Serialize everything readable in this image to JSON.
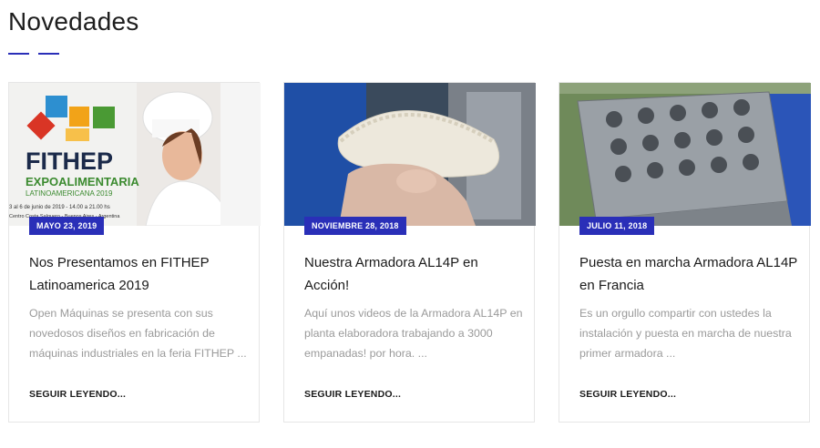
{
  "section": {
    "title": "Novedades",
    "accent_color": "#2a2fb8"
  },
  "posts": [
    {
      "date": "MAYO 23, 2019",
      "title": "Nos Presentamos en FITHEP Latinoamerica 2019",
      "excerpt": "Open Máquinas se presenta con sus novedosos diseños en fabricación de máquinas industriales en la feria FITHEP ...",
      "read_more": "SEGUIR LEYENDO...",
      "image": {
        "logo_text": "FITHEP",
        "logo_sub": "EXPOALIMENTARIA",
        "logo_sub2": "LATINOAMERICANA 2019",
        "event_info": "3 al 6 de junio de 2019 - 14.00 a 21.00 hs",
        "venue": "Centro Costa Salguero - Buenos Aires - Argentina"
      }
    },
    {
      "date": "NOVIEMBRE 28, 2018",
      "title": "Nuestra Armadora AL14P en Acción!",
      "excerpt": "Aquí unos videos de la Armadora AL14P en planta elaboradora trabajando a 3000 empanadas! por hora. ...",
      "read_more": "SEGUIR LEYENDO..."
    },
    {
      "date": "JULIO 11, 2018",
      "title": "Puesta en marcha Armadora AL14P en Francia",
      "excerpt": "Es un orgullo compartir con ustedes la instalación y puesta en marcha de nuestra primer armadora ...",
      "read_more": "SEGUIR LEYENDO..."
    }
  ]
}
